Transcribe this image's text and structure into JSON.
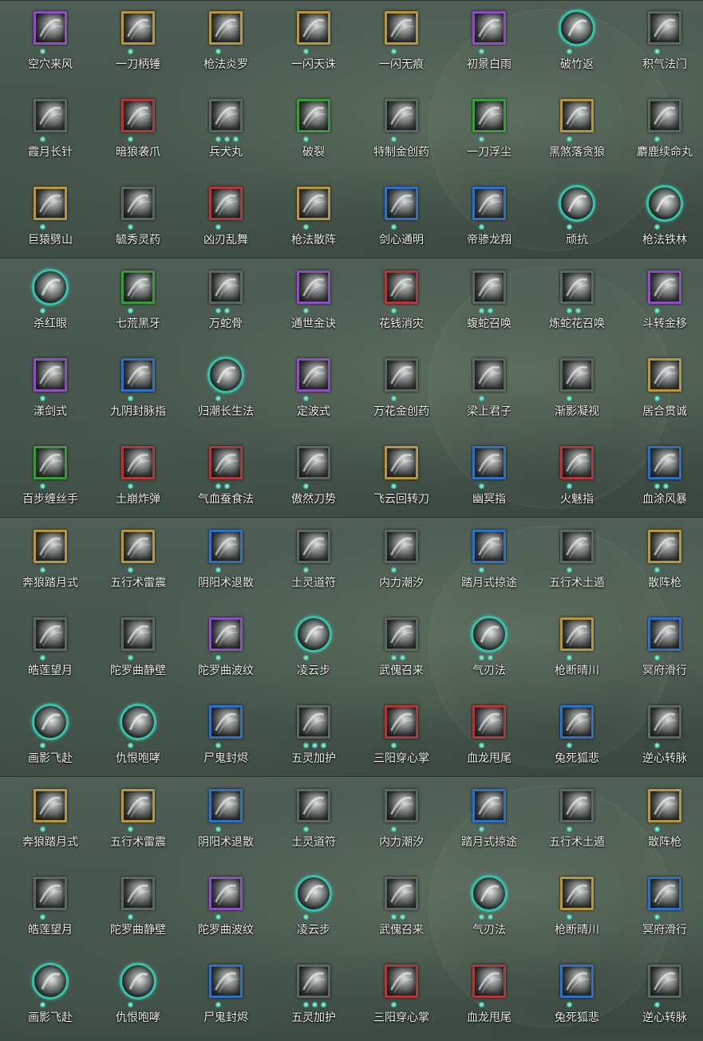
{
  "frame_colors": {
    "purple": "#8e4fc1",
    "gold": "#b6963f",
    "red": "#b0383a",
    "green": "#3a9a3e",
    "blue": "#2f6fc4",
    "teal": "#34c3a8",
    "gray": "#5b6760"
  },
  "dot_color": "#43c1a5",
  "rows": [
    [
      {
        "name": "空穴来风",
        "frame": "purple",
        "shape": "square",
        "level": 1
      },
      {
        "name": "一刀柄锤",
        "frame": "gold",
        "shape": "square",
        "level": 1
      },
      {
        "name": "枪法炎罗",
        "frame": "gold",
        "shape": "square",
        "level": 1
      },
      {
        "name": "一闪天诛",
        "frame": "gold",
        "shape": "square",
        "level": 1
      },
      {
        "name": "一闪无痕",
        "frame": "gold",
        "shape": "square",
        "level": 1
      },
      {
        "name": "初景白雨",
        "frame": "purple",
        "shape": "square",
        "level": 1
      },
      {
        "name": "破竹返",
        "frame": "teal",
        "shape": "circle",
        "level": 1
      },
      {
        "name": "积气法门",
        "frame": "gray",
        "shape": "square",
        "level": 1
      }
    ],
    [
      {
        "name": "霞月长针",
        "frame": "gray",
        "shape": "square",
        "level": 1
      },
      {
        "name": "暗狼袭爪",
        "frame": "red",
        "shape": "square",
        "level": 1
      },
      {
        "name": "兵犬丸",
        "frame": "gray",
        "shape": "square",
        "level": 3
      },
      {
        "name": "破裂",
        "frame": "green",
        "shape": "square",
        "level": 1
      },
      {
        "name": "特制金创药",
        "frame": "gray",
        "shape": "square",
        "level": 1
      },
      {
        "name": "一刀浮尘",
        "frame": "green",
        "shape": "square",
        "level": 1
      },
      {
        "name": "黑煞落贪狼",
        "frame": "gold",
        "shape": "square",
        "level": 1
      },
      {
        "name": "麝鹿续命丸",
        "frame": "gray",
        "shape": "square",
        "level": 1
      }
    ],
    [
      {
        "name": "巨猿劈山",
        "frame": "gold",
        "shape": "square",
        "level": 1
      },
      {
        "name": "毓秀灵药",
        "frame": "gray",
        "shape": "square",
        "level": 1
      },
      {
        "name": "凶刃乱舞",
        "frame": "red",
        "shape": "square",
        "level": 1
      },
      {
        "name": "枪法散阵",
        "frame": "gold",
        "shape": "square",
        "level": 1
      },
      {
        "name": "剑心通明",
        "frame": "blue",
        "shape": "square",
        "level": 1
      },
      {
        "name": "帝骖龙翔",
        "frame": "blue",
        "shape": "square",
        "level": 1
      },
      {
        "name": "顽抗",
        "frame": "teal",
        "shape": "circle",
        "level": 1
      },
      {
        "name": "枪法铁林",
        "frame": "teal",
        "shape": "circle",
        "level": 1
      }
    ],
    [
      {
        "name": "杀红眼",
        "frame": "teal",
        "shape": "circle",
        "level": 1
      },
      {
        "name": "七荒黑牙",
        "frame": "green",
        "shape": "square",
        "level": 1
      },
      {
        "name": "万蛇骨",
        "frame": "gray",
        "shape": "square",
        "level": 2
      },
      {
        "name": "通世金诀",
        "frame": "purple",
        "shape": "square",
        "level": 1
      },
      {
        "name": "花钱消灾",
        "frame": "red",
        "shape": "square",
        "level": 1
      },
      {
        "name": "蝮蛇召唤",
        "frame": "gray",
        "shape": "square",
        "level": 2
      },
      {
        "name": "炼蛇花召唤",
        "frame": "gray",
        "shape": "square",
        "level": 2
      },
      {
        "name": "斗转金移",
        "frame": "purple",
        "shape": "square",
        "level": 1
      }
    ],
    [
      {
        "name": "漾剑式",
        "frame": "purple",
        "shape": "square",
        "level": 1
      },
      {
        "name": "九阴封脉指",
        "frame": "blue",
        "shape": "square",
        "level": 1
      },
      {
        "name": "归潮长生法",
        "frame": "teal",
        "shape": "circle",
        "level": 1
      },
      {
        "name": "定波式",
        "frame": "purple",
        "shape": "square",
        "level": 1
      },
      {
        "name": "万花金创药",
        "frame": "gray",
        "shape": "square",
        "level": 1
      },
      {
        "name": "梁上君子",
        "frame": "gray",
        "shape": "square",
        "level": 1
      },
      {
        "name": "渐影凝视",
        "frame": "gray",
        "shape": "square",
        "level": 1
      },
      {
        "name": "居合贯诚",
        "frame": "gold",
        "shape": "square",
        "level": 1
      }
    ],
    [
      {
        "name": "百步缠丝手",
        "frame": "green",
        "shape": "square",
        "level": 1
      },
      {
        "name": "土崩炸弹",
        "frame": "red",
        "shape": "square",
        "level": 1
      },
      {
        "name": "气血蚕食法",
        "frame": "red",
        "shape": "square",
        "level": 2
      },
      {
        "name": "傲然刀势",
        "frame": "gray",
        "shape": "square",
        "level": 1
      },
      {
        "name": "飞云回转刀",
        "frame": "gold",
        "shape": "square",
        "level": 1
      },
      {
        "name": "幽冥指",
        "frame": "blue",
        "shape": "square",
        "level": 1
      },
      {
        "name": "火魅指",
        "frame": "red",
        "shape": "square",
        "level": 1
      },
      {
        "name": "血涂风暴",
        "frame": "blue",
        "shape": "square",
        "level": 2
      }
    ],
    [
      {
        "name": "奔狼踏月式",
        "frame": "gold",
        "shape": "square",
        "level": 1
      },
      {
        "name": "五行术雷震",
        "frame": "gold",
        "shape": "square",
        "level": 1
      },
      {
        "name": "阴阳术退散",
        "frame": "blue",
        "shape": "square",
        "level": 1
      },
      {
        "name": "土灵道符",
        "frame": "gray",
        "shape": "square",
        "level": 1
      },
      {
        "name": "内力潮汐",
        "frame": "gray",
        "shape": "square",
        "level": 1
      },
      {
        "name": "踏月式掠途",
        "frame": "blue",
        "shape": "square",
        "level": 1
      },
      {
        "name": "五行术土遁",
        "frame": "gray",
        "shape": "square",
        "level": 1
      },
      {
        "name": "散阵枪",
        "frame": "gold",
        "shape": "square",
        "level": 1
      }
    ],
    [
      {
        "name": "皓莲望月",
        "frame": "gray",
        "shape": "square",
        "level": 1
      },
      {
        "name": "陀罗曲静壁",
        "frame": "gray",
        "shape": "square",
        "level": 1
      },
      {
        "name": "陀罗曲波纹",
        "frame": "purple",
        "shape": "square",
        "level": 1
      },
      {
        "name": "凌云步",
        "frame": "teal",
        "shape": "circle",
        "level": 1
      },
      {
        "name": "武傀召来",
        "frame": "gray",
        "shape": "square",
        "level": 2
      },
      {
        "name": "气刃法",
        "frame": "teal",
        "shape": "circle",
        "level": 2
      },
      {
        "name": "枪断晴川",
        "frame": "gold",
        "shape": "square",
        "level": 1
      },
      {
        "name": "冥府滑行",
        "frame": "blue",
        "shape": "square",
        "level": 1
      }
    ],
    [
      {
        "name": "画影飞赴",
        "frame": "teal",
        "shape": "circle",
        "level": 1
      },
      {
        "name": "仇恨咆哮",
        "frame": "teal",
        "shape": "circle",
        "level": 1
      },
      {
        "name": "尸鬼封烬",
        "frame": "blue",
        "shape": "square",
        "level": 1
      },
      {
        "name": "五灵加护",
        "frame": "gray",
        "shape": "square",
        "level": 3
      },
      {
        "name": "三阳穿心掌",
        "frame": "red",
        "shape": "square",
        "level": 1
      },
      {
        "name": "血龙甩尾",
        "frame": "red",
        "shape": "square",
        "level": 1
      },
      {
        "name": "兔死狐悲",
        "frame": "blue",
        "shape": "square",
        "level": 1
      },
      {
        "name": "逆心转脉",
        "frame": "gray",
        "shape": "square",
        "level": 1
      }
    ],
    [
      {
        "name": "奔狼踏月式",
        "frame": "gold",
        "shape": "square",
        "level": 1
      },
      {
        "name": "五行术雷震",
        "frame": "gold",
        "shape": "square",
        "level": 1
      },
      {
        "name": "阴阳术退散",
        "frame": "blue",
        "shape": "square",
        "level": 1
      },
      {
        "name": "土灵道符",
        "frame": "gray",
        "shape": "square",
        "level": 1
      },
      {
        "name": "内力潮汐",
        "frame": "gray",
        "shape": "square",
        "level": 1
      },
      {
        "name": "踏月式掠途",
        "frame": "blue",
        "shape": "square",
        "level": 1
      },
      {
        "name": "五行术土遁",
        "frame": "gray",
        "shape": "square",
        "level": 1
      },
      {
        "name": "散阵枪",
        "frame": "gold",
        "shape": "square",
        "level": 1
      }
    ],
    [
      {
        "name": "皓莲望月",
        "frame": "gray",
        "shape": "square",
        "level": 1
      },
      {
        "name": "陀罗曲静壁",
        "frame": "gray",
        "shape": "square",
        "level": 1
      },
      {
        "name": "陀罗曲波纹",
        "frame": "purple",
        "shape": "square",
        "level": 1
      },
      {
        "name": "凌云步",
        "frame": "teal",
        "shape": "circle",
        "level": 1
      },
      {
        "name": "武傀召来",
        "frame": "gray",
        "shape": "square",
        "level": 2
      },
      {
        "name": "气刃法",
        "frame": "teal",
        "shape": "circle",
        "level": 2
      },
      {
        "name": "枪断晴川",
        "frame": "gold",
        "shape": "square",
        "level": 1
      },
      {
        "name": "冥府滑行",
        "frame": "blue",
        "shape": "square",
        "level": 1
      }
    ],
    [
      {
        "name": "画影飞赴",
        "frame": "teal",
        "shape": "circle",
        "level": 1
      },
      {
        "name": "仇恨咆哮",
        "frame": "teal",
        "shape": "circle",
        "level": 1
      },
      {
        "name": "尸鬼封烬",
        "frame": "blue",
        "shape": "square",
        "level": 1
      },
      {
        "name": "五灵加护",
        "frame": "gray",
        "shape": "square",
        "level": 3
      },
      {
        "name": "三阳穿心掌",
        "frame": "red",
        "shape": "square",
        "level": 1
      },
      {
        "name": "血龙甩尾",
        "frame": "red",
        "shape": "square",
        "level": 1
      },
      {
        "name": "兔死狐悲",
        "frame": "blue",
        "shape": "square",
        "level": 1
      },
      {
        "name": "逆心转脉",
        "frame": "gray",
        "shape": "square",
        "level": 1
      }
    ]
  ]
}
